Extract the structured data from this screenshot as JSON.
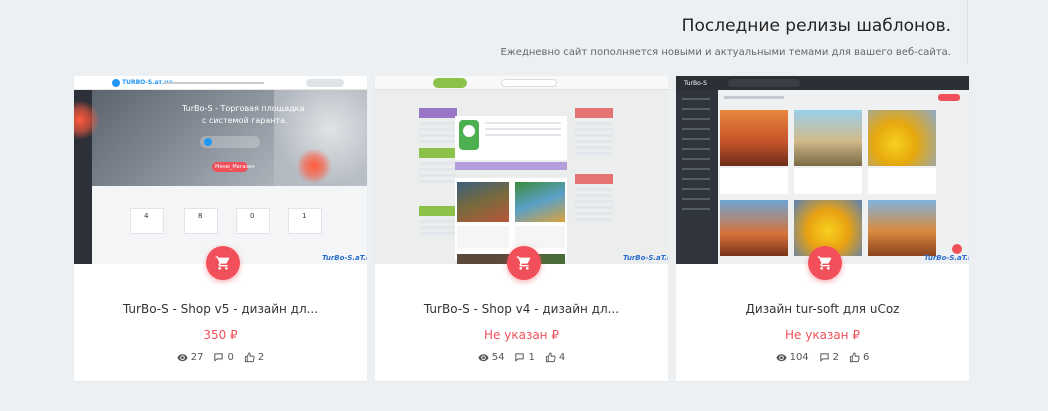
{
  "header": {
    "title": "Последние релизы шаблонов.",
    "subtitle": "Ежедневно сайт пополняется новыми и актуальными темами для вашего веб-сайта."
  },
  "cards": [
    {
      "title": "TurBo-S - Shop v5 - дизайн дл...",
      "price": "350 ₽",
      "views": "27",
      "comments": "0",
      "likes": "2",
      "preview": {
        "brand": "TURBO-S.ат.ua",
        "hero_line1": "TurBo-S - Торговая площадка",
        "hero_line2": "с системой гаранта.",
        "hero_button": "Меню_Магазин",
        "counters": [
          "4",
          "8",
          "0",
          "1"
        ],
        "watermark": "TurBo-S.aT.uA"
      }
    },
    {
      "title": "TurBo-S - Shop v4 - дизайн дл...",
      "price": "Не указан ₽",
      "views": "54",
      "comments": "1",
      "likes": "4",
      "preview": {
        "watermark": "TurBo-S.aT.uA"
      }
    },
    {
      "title": "Дизайн tur-soft для uCoz",
      "price": "Не указан ₽",
      "views": "104",
      "comments": "2",
      "likes": "6",
      "preview": {
        "brand": "TurBo-S",
        "watermark": "TurBo-S.aT.uA"
      }
    }
  ],
  "colors": {
    "accent": "#f1505a",
    "background": "#edf0f3",
    "card": "#ffffff"
  }
}
